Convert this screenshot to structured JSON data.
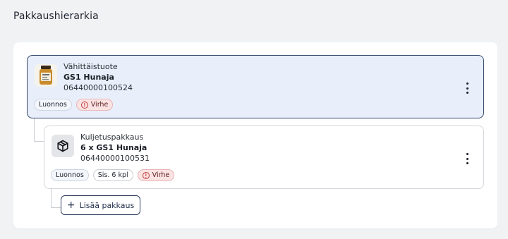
{
  "page": {
    "title": "Pakkaushierarkia"
  },
  "hierarchy": {
    "items": [
      {
        "type": "Vähittäistuote",
        "name": "GS1 Hunaja",
        "code": "06440000100524",
        "thumbnail_icon": "honey-jar-image",
        "badges": {
          "status": "Luonnos",
          "error": "Virhe"
        },
        "selected": true
      },
      {
        "type": "Kuljetuspakkaus",
        "name": "6 x GS1 Hunaja",
        "code": "06440000100531",
        "thumbnail_icon": "package-icon",
        "badges": {
          "status": "Luonnos",
          "contents": "Sis. 6 kpl",
          "error": "Virhe"
        },
        "selected": false
      }
    ],
    "add_button": {
      "label": "Lisää pakkaus",
      "icon": "plus-icon"
    }
  },
  "colors": {
    "selected_bg": "#e9effa",
    "selected_border": "#32476a",
    "error_bg": "#fbe3e3",
    "error_icon": "#c43a3a"
  }
}
